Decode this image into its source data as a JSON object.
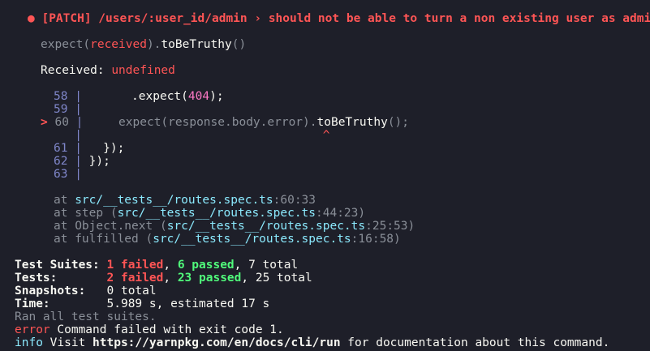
{
  "test_header": {
    "bullet": "●",
    "title": "[PATCH] /users/:user_id/admin › should not be able to turn a non existing user as admin"
  },
  "expectation": {
    "pre": "expect(",
    "received": "received",
    "post": ").",
    "matcher": "toBeTruthy",
    "parens": "()"
  },
  "received_line": {
    "label": "Received: ",
    "value": "undefined"
  },
  "code_frame": [
    {
      "num": "58",
      "code_pre": "       .expect(",
      "code_num": "404",
      "code_post": ");"
    },
    {
      "num": "59",
      "code_pre": "",
      "code_num": "",
      "code_post": ""
    },
    {
      "marker": ">",
      "num": "60",
      "code_pre": "     expect(response.body.error).",
      "code_num": "",
      "code_post": "",
      "matcher": "toBeTruthy",
      "tail": "();"
    },
    {
      "num": "",
      "caret": "^"
    },
    {
      "num": "61",
      "code_pre": "   });",
      "code_num": "",
      "code_post": ""
    },
    {
      "num": "62",
      "code_pre": " });",
      "code_num": "",
      "code_post": ""
    },
    {
      "num": "63",
      "code_pre": "",
      "code_num": "",
      "code_post": ""
    }
  ],
  "stack": [
    {
      "prefix": "at ",
      "path": "src/__tests__/routes.spec.ts",
      "loc": ":60:33",
      "suffix": ""
    },
    {
      "prefix": "at step (",
      "path": "src/__tests__/routes.spec.ts",
      "loc": ":44:23",
      "suffix": ")"
    },
    {
      "prefix": "at Object.next (",
      "path": "src/__tests__/routes.spec.ts",
      "loc": ":25:53",
      "suffix": ")"
    },
    {
      "prefix": "at fulfilled (",
      "path": "src/__tests__/routes.spec.ts",
      "loc": ":16:58",
      "suffix": ")"
    }
  ],
  "summary": {
    "suites_label": "Test Suites: ",
    "suites_failed": "1 failed",
    "suites_passed": "6 passed",
    "suites_total": ", 7 total",
    "tests_label": "Tests:       ",
    "tests_failed": "2 failed",
    "tests_passed": "23 passed",
    "tests_total": ", 25 total",
    "snapshots_label": "Snapshots:   ",
    "snapshots_value": "0 total",
    "time_label": "Time:        ",
    "time_value": "5.989 s, estimated 17 s",
    "ran": "Ran all test suites."
  },
  "yarn": {
    "error_tag": "error",
    "error_msg": " Command failed with exit code 1.",
    "info_tag": "info",
    "info_pre": " Visit ",
    "info_url": "https://yarnpkg.com/en/docs/cli/run",
    "info_post": " for documentation about this command."
  },
  "colors": {
    "background": "#1e1f29",
    "fail": "#ff5555",
    "pass": "#50fa7b",
    "number": "#ff79c6",
    "path": "#8be9fd"
  }
}
